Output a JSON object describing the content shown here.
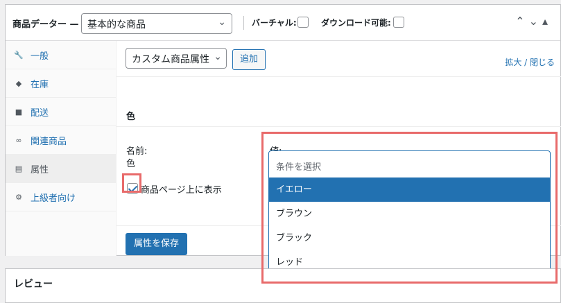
{
  "header": {
    "title": "商品データー —",
    "product_type": "基本的な商品",
    "virtual_label": "バーチャル:",
    "downloadable_label": "ダウンロード可能:"
  },
  "tabs": [
    {
      "label": "一般",
      "icon": "wrench-icon"
    },
    {
      "label": "在庫",
      "icon": "tag-icon"
    },
    {
      "label": "配送",
      "icon": "truck-icon"
    },
    {
      "label": "関連商品",
      "icon": "link-icon"
    },
    {
      "label": "属性",
      "icon": "list-icon"
    },
    {
      "label": "上級者向け",
      "icon": "gear-icon"
    }
  ],
  "toolbar": {
    "attribute_select": "カスタム商品属性",
    "add_label": "追加",
    "expand_label": "拡大 / 閉じる"
  },
  "attribute": {
    "name": "色",
    "name_label": "名前:",
    "name_value": "色",
    "values_label": "値:",
    "visible_label": "商品ページ上に表示",
    "visible_checked": true
  },
  "dropdown": {
    "placeholder": "条件を選択",
    "options": [
      "イエロー",
      "ブラウン",
      "ブラック",
      "レッド"
    ],
    "highlighted": "イエロー"
  },
  "save_label": "属性を保存",
  "review": {
    "title": "レビュー"
  },
  "colors": {
    "accent": "#2271b1",
    "highlight": "#e86a6a"
  }
}
